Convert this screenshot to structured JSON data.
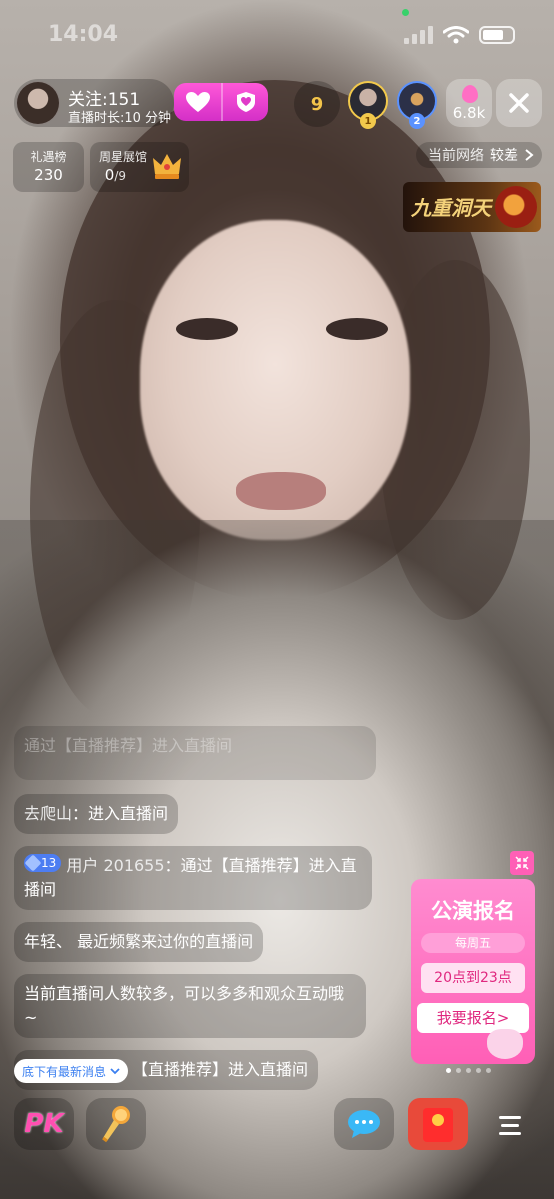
{
  "status_bar": {
    "time": "14:04"
  },
  "host": {
    "follow_label": "关注:151",
    "duration_label": "直播时长:10 分钟"
  },
  "top_bar": {
    "gift_count": "9",
    "viewer_count": "6.8k",
    "viewer_ranks": [
      "1",
      "2"
    ]
  },
  "cards": {
    "gift_rank": {
      "title": "礼遇榜",
      "value": "230"
    },
    "weekly_star": {
      "title": "周星展馆",
      "value_main": "0",
      "value_sub": "/9"
    }
  },
  "network": {
    "label": "当前网络",
    "status": "较差"
  },
  "promo_banner": {
    "title": "九重洞天"
  },
  "chat": {
    "faded_text": "通过【直播推荐】进入直播间",
    "messages": [
      {
        "user": "去爬山",
        "sep": "：",
        "text": "进入直播间"
      },
      {
        "level": "13",
        "user": "用户 201655",
        "sep": "：",
        "text": "通过【直播推荐】进入直播间"
      },
      {
        "text": "年轻、 最近频繁来过你的直播间"
      },
      {
        "text": "当前直播间人数较多，可以多多和观众互动哦~"
      },
      {
        "text": "【直播推荐】进入直播间"
      }
    ],
    "new_message_pill": "底下有最新消息"
  },
  "show_card": {
    "title": "公演报名",
    "day": "每周五",
    "time": "20点到23点",
    "cta": "我要报名>"
  },
  "bottom_bar": {
    "pk_label": "PK"
  },
  "colors": {
    "pink_accent": "#ff5fb6",
    "gold": "#f3c44a",
    "chat_bg": "rgba(0,0,0,0.2)"
  }
}
